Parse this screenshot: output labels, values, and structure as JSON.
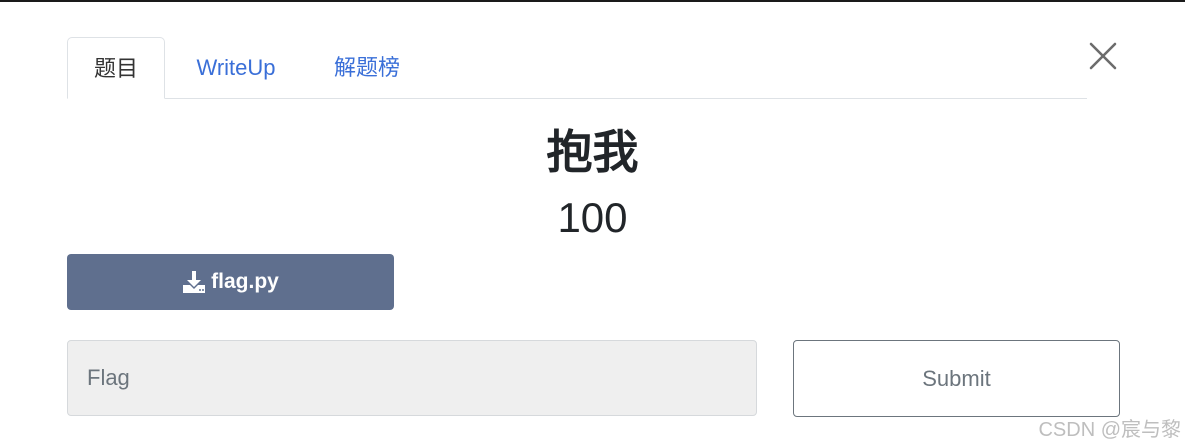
{
  "tabs": [
    {
      "label": "题目",
      "active": true
    },
    {
      "label": "WriteUp",
      "active": false
    },
    {
      "label": "解题榜",
      "active": false
    }
  ],
  "challenge": {
    "name": "抱我",
    "points": "100"
  },
  "file": {
    "name": "flag.py",
    "icon": "download-icon"
  },
  "flag_input": {
    "placeholder": "Flag",
    "value": ""
  },
  "submit": {
    "label": "Submit"
  },
  "watermark": "CSDN @宸与黎",
  "colors": {
    "link": "#3a6fd8",
    "file_button": "#5f6f8e",
    "input_bg": "#efefef"
  }
}
